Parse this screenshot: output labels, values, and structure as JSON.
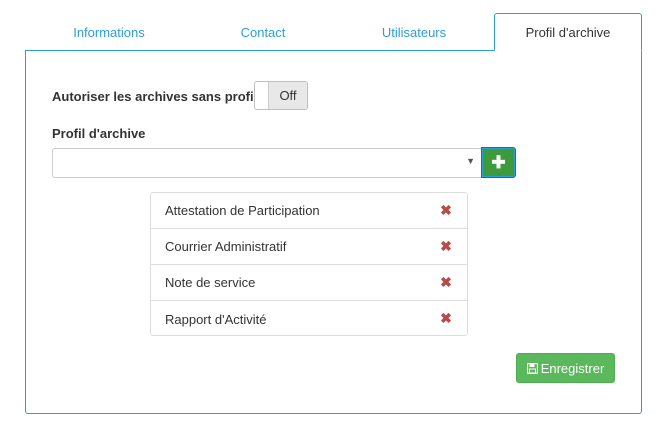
{
  "tabs": [
    {
      "label": "Informations",
      "active": false
    },
    {
      "label": "Contact",
      "active": false
    },
    {
      "label": "Utilisateurs",
      "active": false
    },
    {
      "label": "Profil d'archive",
      "active": true
    }
  ],
  "form": {
    "allow_label": "Autoriser les archives sans profil",
    "toggle_state": "Off",
    "profile_label": "Profil d'archive",
    "select_value": "",
    "add_icon": "plus-icon"
  },
  "profiles": [
    {
      "name": "Attestation de Participation",
      "icon": "remove-icon"
    },
    {
      "name": "Courrier Administratif",
      "icon": "remove-icon"
    },
    {
      "name": "Note de service",
      "icon": "remove-icon"
    },
    {
      "name": "Rapport d'Activité",
      "icon": "remove-icon"
    }
  ],
  "save_button": {
    "label": "Enregistrer",
    "icon": "floppy-disk-icon"
  },
  "colors": {
    "accent": "#2a9fd6",
    "success": "#5cb85c",
    "add": "#3d9b3d",
    "danger": "#b94a48"
  }
}
